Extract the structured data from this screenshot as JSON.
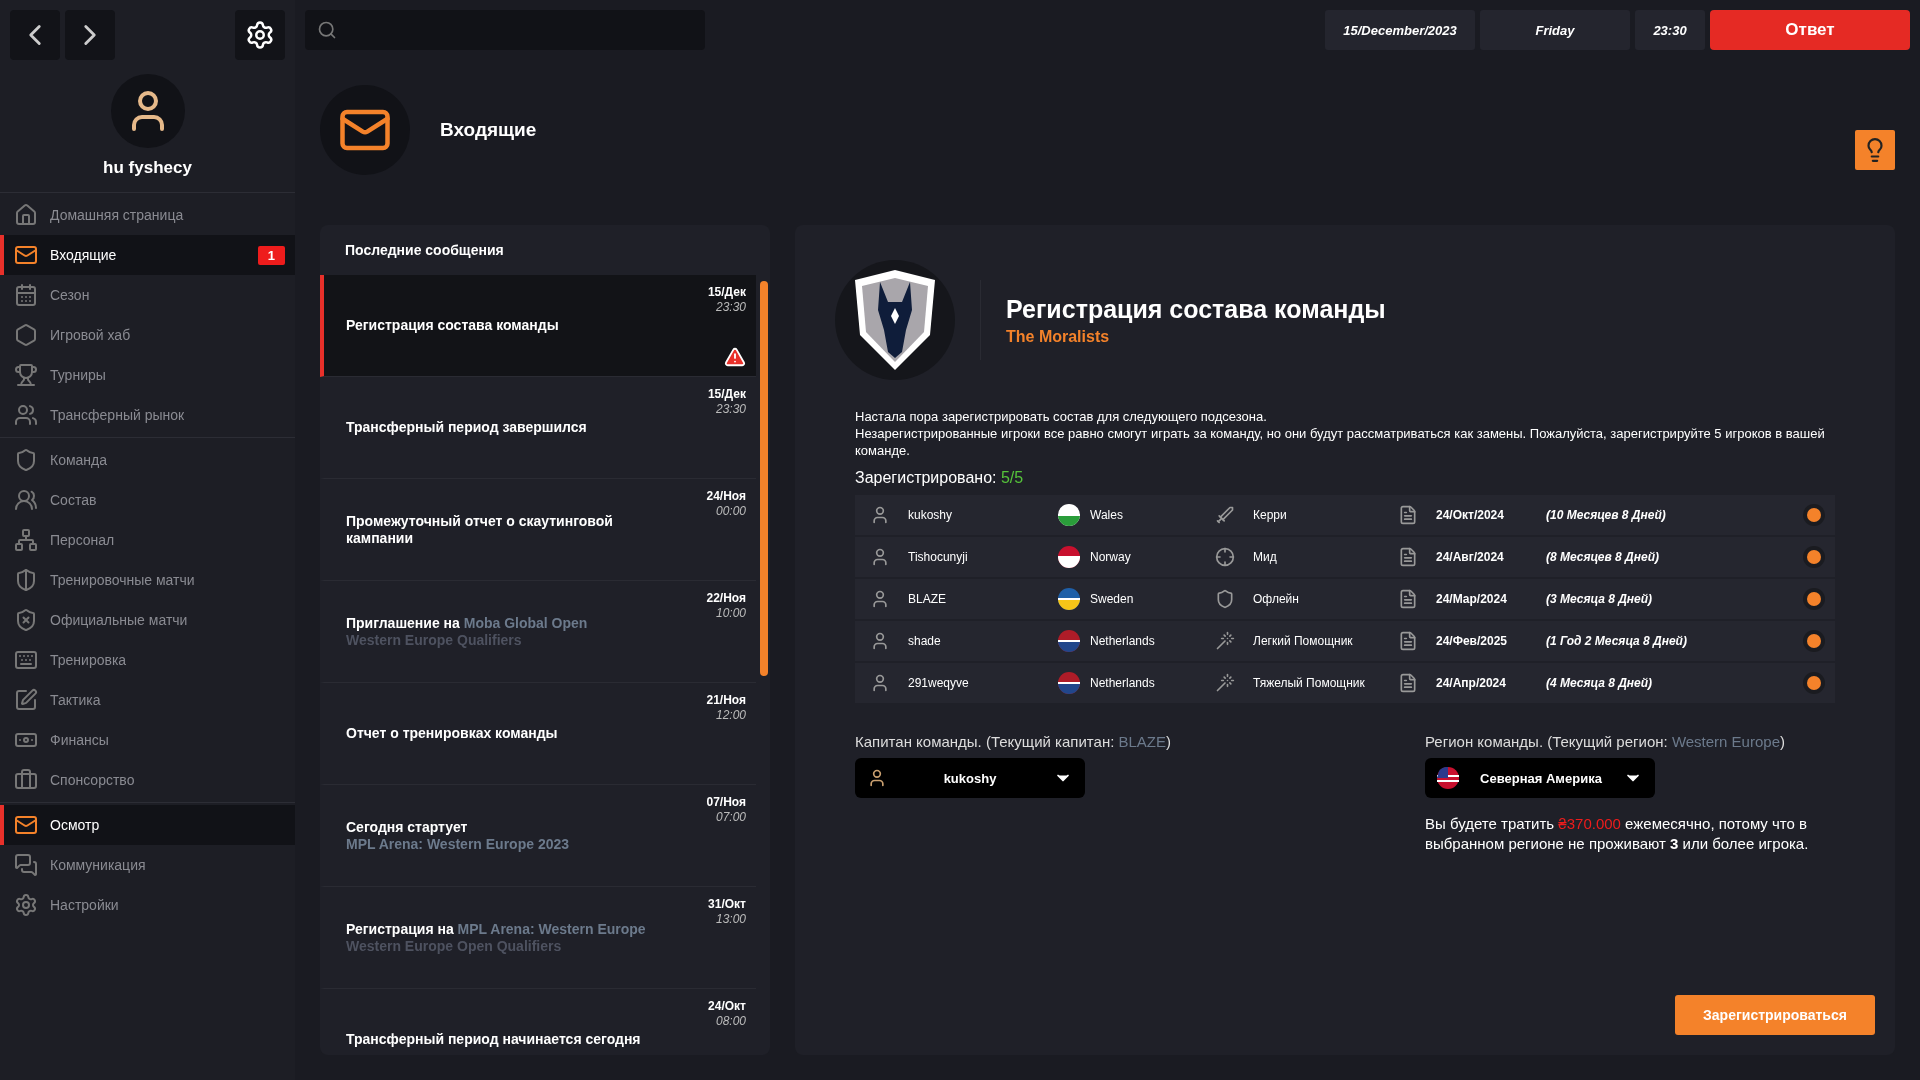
{
  "topbar": {
    "date": "15/December/2023",
    "day": "Friday",
    "time": "23:30",
    "reply_button": "Ответ"
  },
  "profile": {
    "name": "hu fyshecy"
  },
  "sidebar": {
    "groups": [
      [
        {
          "label": "Домашняя страница",
          "selected": false
        },
        {
          "label": "Входящие",
          "selected": true,
          "badge": "1"
        },
        {
          "label": "Сезон",
          "selected": false
        },
        {
          "label": "Игровой хаб",
          "selected": false
        },
        {
          "label": "Турниры",
          "selected": false
        },
        {
          "label": "Трансферный рынок",
          "selected": false
        }
      ],
      [
        {
          "label": "Команда",
          "selected": false
        },
        {
          "label": "Состав",
          "selected": false
        },
        {
          "label": "Персонал",
          "selected": false
        },
        {
          "label": "Тренировочные матчи",
          "selected": false
        },
        {
          "label": "Официальные матчи",
          "selected": false
        },
        {
          "label": "Тренировка",
          "selected": false
        },
        {
          "label": "Тактика",
          "selected": false
        },
        {
          "label": "Финансы",
          "selected": false
        },
        {
          "label": "Спонсорство",
          "selected": false
        }
      ],
      [
        {
          "label": "Осмотр",
          "selected": true
        },
        {
          "label": "Коммуникация",
          "selected": false
        },
        {
          "label": "Настройки",
          "selected": false
        }
      ]
    ]
  },
  "header": {
    "title": "Входящие"
  },
  "messages": {
    "title": "Последние сообщения",
    "items": [
      {
        "title": "Регистрация состава команды",
        "date": "15/Дек",
        "time": "23:30",
        "selected": true,
        "alert": true
      },
      {
        "title": "Трансферный период завершился",
        "date": "15/Дек",
        "time": "23:30",
        "selected": false,
        "alert": false
      },
      {
        "title": "Промежуточный отчет о скаутинговой кампании",
        "date": "24/Ноя",
        "time": "00:00",
        "selected": false,
        "alert": false
      },
      {
        "title": "Приглашение на",
        "link": "Moba Global Open",
        "subtitle": "Western Europe Qualifiers",
        "date": "22/Ноя",
        "time": "10:00",
        "selected": false,
        "alert": false
      },
      {
        "title": "Отчет о тренировках команды",
        "date": "21/Ноя",
        "time": "12:00",
        "selected": false,
        "alert": false
      },
      {
        "title": "Сегодня стартует",
        "link": "MPL Arena: Western Europe 2023",
        "link_newline": true,
        "date": "07/Ноя",
        "time": "07:00",
        "selected": false,
        "alert": false
      },
      {
        "title": "Регистрация на",
        "link": "MPL Arena: Western Europe",
        "subtitle": "Western Europe Open Qualifiers",
        "date": "31/Окт",
        "time": "13:00",
        "selected": false,
        "alert": false
      },
      {
        "title": "Трансферный период начинается сегодня",
        "date": "24/Окт",
        "time": "08:00",
        "selected": false,
        "alert": false
      }
    ]
  },
  "detail": {
    "title": "Регистрация состава команды",
    "team": "The Moralists",
    "paragraphs": [
      "Настала пора зарегистрировать состав для следующего подсезона.",
      "Незарегистрированные игроки все равно смогут играть за команду, но они будут рассматриваться как замены. Пожалуйста, зарегистрируйте 5 игроков в вашей команде."
    ],
    "registered_label": "Зарегистрировано:",
    "registered_count": "5/5",
    "players": [
      {
        "name": "kukoshy",
        "country": "Wales",
        "role": "Керри",
        "date": "24/Окт/2024",
        "duration": "(10 Месяцев 8 Дней)"
      },
      {
        "name": "Tishocunyji",
        "country": "Norway",
        "role": "Мид",
        "date": "24/Авг/2024",
        "duration": "(8 Месяцев 8 Дней)"
      },
      {
        "name": "BLAZE",
        "country": "Sweden",
        "role": "Офлейн",
        "date": "24/Мар/2024",
        "duration": "(3 Месяца 8 Дней)"
      },
      {
        "name": "shade",
        "country": "Netherlands",
        "role": "Легкий Помощник",
        "date": "24/Фев/2025",
        "duration": "(1 Год 2 Месяца 8 Дней)"
      },
      {
        "name": "291weqyve",
        "country": "Netherlands",
        "role": "Тяжелый Помощник",
        "date": "24/Апр/2024",
        "duration": "(4 Месяца 8 Дней)"
      }
    ],
    "captain": {
      "label": "Капитан команды. (Текущий капитан:",
      "current": "BLAZE",
      "close": ")",
      "value": "kukoshy"
    },
    "region": {
      "label": "Регион команды. (Текущий регион:",
      "current": "Western Europe",
      "close": ")",
      "value": "Северная Америка"
    },
    "cost_note": {
      "before": "Вы будете тратить",
      "amount": "₴370.000",
      "after": "ежемесячно, потому что в выбранном регионе не проживают **3** или более игрока."
    },
    "register_button": "Зарегистрироваться"
  }
}
